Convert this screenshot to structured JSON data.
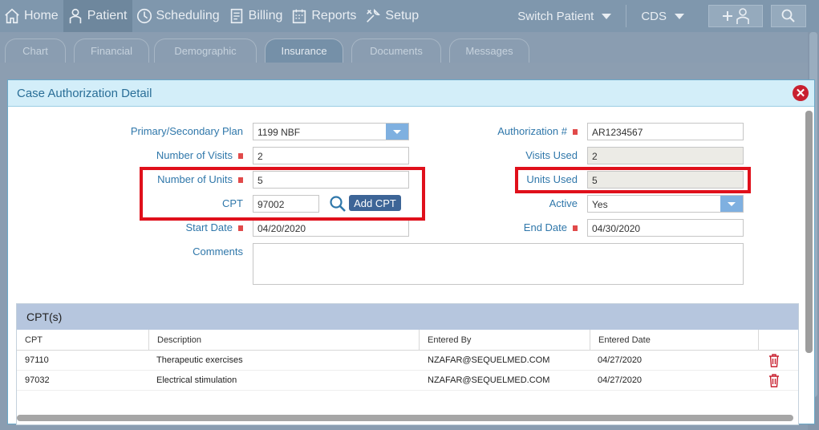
{
  "nav": {
    "items": [
      {
        "label": "Home",
        "icon": "home-icon"
      },
      {
        "label": "Patient",
        "icon": "patient-icon"
      },
      {
        "label": "Scheduling",
        "icon": "clock-icon"
      },
      {
        "label": "Billing",
        "icon": "billing-icon"
      },
      {
        "label": "Reports",
        "icon": "calendar-icon"
      },
      {
        "label": "Setup",
        "icon": "wrench-icon"
      }
    ],
    "switch_patient": "Switch Patient",
    "cds": "CDS"
  },
  "tabs": [
    "Chart",
    "Financial",
    "Demographic",
    "Insurance",
    "Documents",
    "Messages"
  ],
  "active_tab": "Insurance",
  "modal": {
    "title": "Case Authorization Detail",
    "fields": {
      "primary_plan": {
        "label": "Primary/Secondary Plan",
        "value": "1199 NBF"
      },
      "num_visits": {
        "label": "Number of Visits",
        "value": "2"
      },
      "num_units": {
        "label": "Number of Units",
        "value": "5"
      },
      "cpt": {
        "label": "CPT",
        "value": "97002"
      },
      "start_date": {
        "label": "Start Date",
        "value": "04/20/2020"
      },
      "comments": {
        "label": "Comments",
        "value": ""
      },
      "auth_no": {
        "label": "Authorization #",
        "value": "AR1234567"
      },
      "visits_used": {
        "label": "Visits Used",
        "value": "2"
      },
      "units_used": {
        "label": "Units Used",
        "value": "5"
      },
      "active": {
        "label": "Active",
        "value": "Yes"
      },
      "end_date": {
        "label": "End Date",
        "value": "04/30/2020"
      }
    },
    "add_cpt_label": "Add CPT"
  },
  "cpt_table": {
    "title": "CPT(s)",
    "columns": [
      "CPT",
      "Description",
      "Entered By",
      "Entered Date"
    ],
    "rows": [
      {
        "cpt": "97110",
        "description": "Therapeutic exercises",
        "entered_by": "NZAFAR@SEQUELMED.COM",
        "entered_date": "04/27/2020"
      },
      {
        "cpt": "97032",
        "description": "Electrical stimulation",
        "entered_by": "NZAFAR@SEQUELMED.COM",
        "entered_date": "04/27/2020"
      }
    ]
  },
  "colors": {
    "highlight": "#e0101b",
    "label_blue": "#2f77aa",
    "header_bg": "#d3eef9"
  }
}
